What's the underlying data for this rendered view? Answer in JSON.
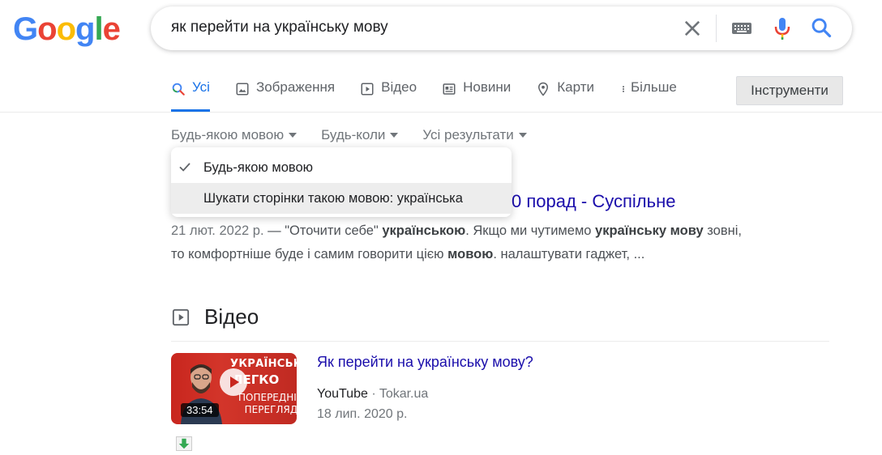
{
  "logo": {
    "text": "Google",
    "letters": [
      "G",
      "o",
      "o",
      "g",
      "l",
      "e"
    ],
    "colors": [
      "#4285f4",
      "#ea4335",
      "#fbbc05",
      "#4285f4",
      "#34a853",
      "#ea4335"
    ]
  },
  "search": {
    "query": "як перейти на українську мову"
  },
  "tabs": [
    {
      "label": "Усі",
      "icon": "search-icon",
      "active": true
    },
    {
      "label": "Зображення",
      "icon": "image-icon"
    },
    {
      "label": "Відео",
      "icon": "video-icon"
    },
    {
      "label": "Новини",
      "icon": "news-icon"
    },
    {
      "label": "Карти",
      "icon": "map-pin-icon"
    },
    {
      "label": "Більше",
      "icon": "more-icon"
    }
  ],
  "tools": {
    "label": "Інструменти"
  },
  "filters": [
    {
      "label": "Будь-якою мовою"
    },
    {
      "label": "Будь-коли"
    },
    {
      "label": "Усі результати"
    }
  ],
  "dropdown": {
    "items": [
      {
        "label": "Будь-якою мовою",
        "checked": true
      },
      {
        "label": "Шукати сторінки такою мовою: українська",
        "checked": false
      }
    ]
  },
  "result": {
    "title_visible": "0 порад - Суспільне",
    "date": "21 лют. 2022 р.",
    "snippet_parts": {
      "p1": " — \"Оточити себе\" ",
      "b1": "українською",
      "p2": ". Якщо ми чутимемо ",
      "b2": "українську мову",
      "p3": " зовні,",
      "p4": "то комфортніше буде і самим говорити цією ",
      "b3": "мовою",
      "p5": ". налаштувати гаджет, ..."
    }
  },
  "videos": {
    "heading": "Відео",
    "items": [
      {
        "title": "Як перейти на українську мову?",
        "source": "YouTube",
        "channel": "· Tokar.ua",
        "date": "18 лип. 2020 р.",
        "duration": "33:54",
        "thumb_text_1": "УКРАЇНСЬКА",
        "thumb_text_2": "ЛЕГКО",
        "thumb_text_3a": "ПОПЕРЕДНІЙ",
        "thumb_text_3b": "ПЕРЕГЛЯД"
      }
    ]
  },
  "colors": {
    "link": "#1a0dab",
    "accent": "#1a73e8",
    "muted": "#70757a"
  }
}
